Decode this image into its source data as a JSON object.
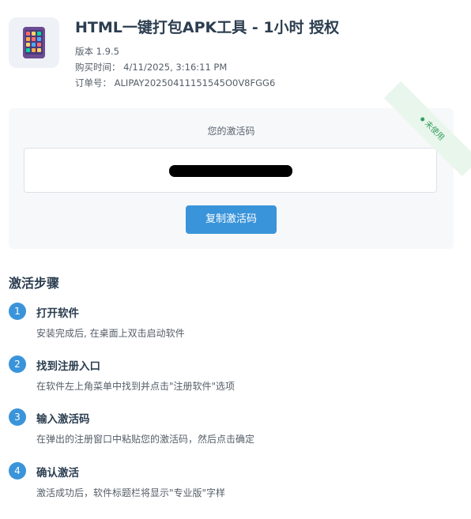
{
  "product": {
    "title": "HTML一键打包APK工具 - 1小时 授权",
    "version": "版本 1.9.5",
    "purchase_time": "购买时间： 4/11/2025, 3:16:11 PM",
    "order_number": "订单号： ALIPAY20250411151545O0V8FGG6",
    "icon": "phone-app-icon"
  },
  "activation": {
    "label": "您的激活码",
    "code_value": "",
    "copy_button_label": "复制激活码",
    "status": "未使用"
  },
  "steps_section": {
    "heading": "激活步骤",
    "steps": [
      {
        "number": "1",
        "title": "打开软件",
        "description": "安装完成后, 在桌面上双击启动软件"
      },
      {
        "number": "2",
        "title": "找到注册入口",
        "description": "在软件左上角菜单中找到并点击\"注册软件\"选项"
      },
      {
        "number": "3",
        "title": "输入激活码",
        "description": "在弹出的注册窗口中粘贴您的激活码，然后点击确定"
      },
      {
        "number": "4",
        "title": "确认激活",
        "description": "激活成功后，软件标题栏将显示\"专业版\"字样"
      }
    ]
  },
  "colors": {
    "accent": "#3a94da",
    "status_green": "#2e9a58",
    "title_text": "#2c3e50"
  }
}
